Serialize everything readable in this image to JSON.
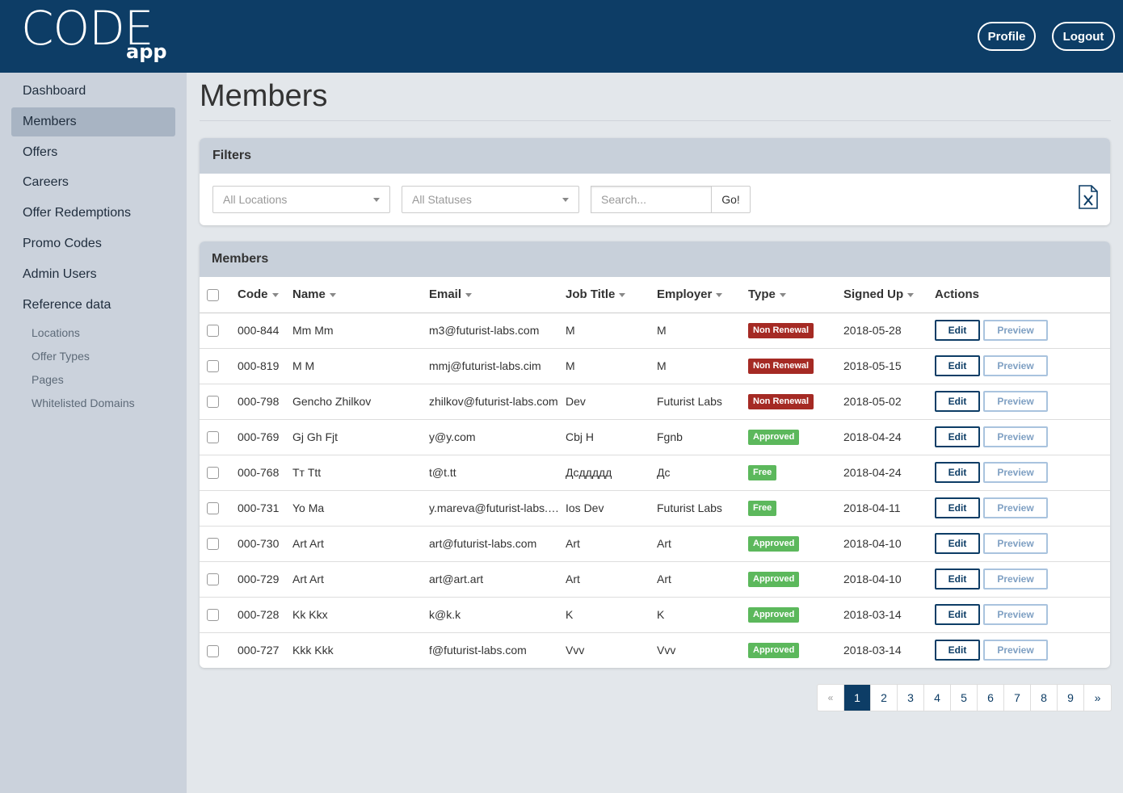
{
  "header": {
    "logo_main": "CODE",
    "logo_sub": "app",
    "profile_label": "Profile",
    "logout_label": "Logout"
  },
  "sidebar": {
    "items": [
      {
        "label": "Dashboard",
        "active": false
      },
      {
        "label": "Members",
        "active": true
      },
      {
        "label": "Offers",
        "active": false
      },
      {
        "label": "Careers",
        "active": false
      },
      {
        "label": "Offer Redemptions",
        "active": false
      },
      {
        "label": "Promo Codes",
        "active": false
      },
      {
        "label": "Admin Users",
        "active": false
      },
      {
        "label": "Reference data",
        "active": false
      }
    ],
    "subitems": [
      {
        "label": "Locations"
      },
      {
        "label": "Offer Types"
      },
      {
        "label": "Pages"
      },
      {
        "label": "Whitelisted Domains"
      }
    ]
  },
  "page": {
    "title": "Members"
  },
  "filters": {
    "title": "Filters",
    "locations_value": "All Locations",
    "statuses_value": "All Statuses",
    "search_placeholder": "Search...",
    "go_label": "Go!",
    "export_icon": "excel-export-icon"
  },
  "members": {
    "title": "Members",
    "columns": [
      "Code",
      "Name",
      "Email",
      "Job Title",
      "Employer",
      "Type",
      "Signed Up",
      "Actions"
    ],
    "edit_label": "Edit",
    "preview_label": "Preview",
    "rows": [
      {
        "code": "000-844",
        "name": "Mm Mm",
        "email": "m3@futurist-labs.com",
        "job": "M",
        "employer": "M",
        "type": "Non Renewal",
        "type_color": "#a52a24",
        "signed": "2018-05-28"
      },
      {
        "code": "000-819",
        "name": "M M",
        "email": "mmj@futurist-labs.cim",
        "job": "M",
        "employer": "M",
        "type": "Non Renewal",
        "type_color": "#a52a24",
        "signed": "2018-05-15"
      },
      {
        "code": "000-798",
        "name": "Gencho Zhilkov",
        "email": "zhilkov@futurist-labs.com",
        "job": "Dev",
        "employer": "Futurist Labs",
        "type": "Non Renewal",
        "type_color": "#a52a24",
        "signed": "2018-05-02"
      },
      {
        "code": "000-769",
        "name": "Gj Gh Fjt",
        "email": "y@y.com",
        "job": "Cbj H",
        "employer": "Fgnb",
        "type": "Approved",
        "type_color": "#5cb85c",
        "signed": "2018-04-24"
      },
      {
        "code": "000-768",
        "name": "Тт Ttt",
        "email": "t@t.tt",
        "job": "Дсддддд",
        "employer": "Дс",
        "type": "Free",
        "type_color": "#5cb85c",
        "signed": "2018-04-24"
      },
      {
        "code": "000-731",
        "name": "Yo Ma",
        "email": "y.mareva@futurist-labs.com",
        "job": "Ios Dev",
        "employer": "Futurist Labs",
        "type": "Free",
        "type_color": "#5cb85c",
        "signed": "2018-04-11"
      },
      {
        "code": "000-730",
        "name": "Art Art",
        "email": "art@futurist-labs.com",
        "job": "Art",
        "employer": "Art",
        "type": "Approved",
        "type_color": "#5cb85c",
        "signed": "2018-04-10"
      },
      {
        "code": "000-729",
        "name": "Art Art",
        "email": "art@art.art",
        "job": "Art",
        "employer": "Art",
        "type": "Approved",
        "type_color": "#5cb85c",
        "signed": "2018-04-10"
      },
      {
        "code": "000-728",
        "name": "Kk Kkx",
        "email": "k@k.k",
        "job": "K",
        "employer": "K",
        "type": "Approved",
        "type_color": "#5cb85c",
        "signed": "2018-03-14"
      },
      {
        "code": "000-727",
        "name": "Kkk Kkk",
        "email": "f@futurist-labs.com",
        "job": "Vvv",
        "employer": "Vvv",
        "type": "Approved",
        "type_color": "#5cb85c",
        "signed": "2018-03-14"
      }
    ]
  },
  "pagination": {
    "prev": "«",
    "next": "»",
    "pages": [
      "1",
      "2",
      "3",
      "4",
      "5",
      "6",
      "7",
      "8",
      "9"
    ],
    "current": "1"
  },
  "colors": {
    "brand": "#0d3d66",
    "danger": "#a52a24",
    "success": "#5cb85c"
  }
}
